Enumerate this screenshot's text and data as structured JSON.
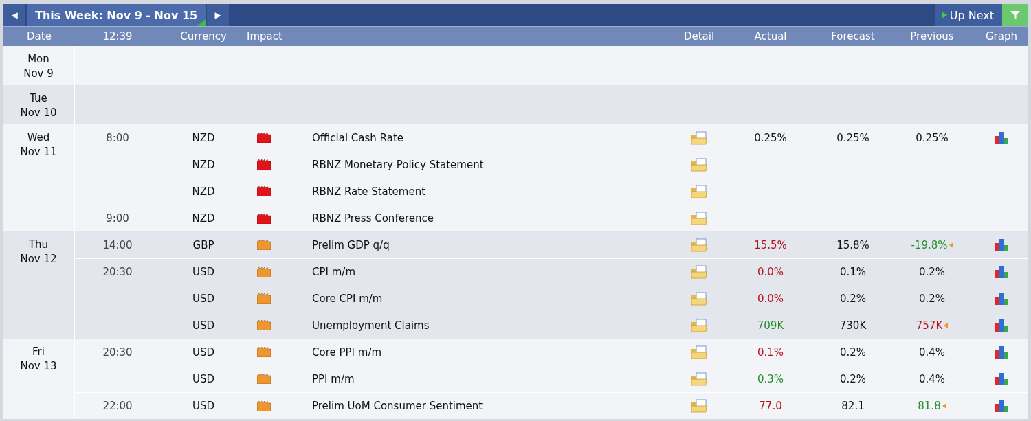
{
  "toolbar": {
    "prev": "◀",
    "title": "This Week: Nov 9 - Nov 15",
    "next": "▶",
    "up_next": "Up Next"
  },
  "columns": {
    "date": "Date",
    "time": "12:39",
    "currency": "Currency",
    "impact": "Impact",
    "detail": "Detail",
    "actual": "Actual",
    "forecast": "Forecast",
    "previous": "Previous",
    "graph": "Graph"
  },
  "days": [
    {
      "weekday": "Mon",
      "date": "Nov 9"
    },
    {
      "weekday": "Tue",
      "date": "Nov 10"
    },
    {
      "weekday": "Wed",
      "date": "Nov 11",
      "events": [
        {
          "time": "8:00",
          "currency": "NZD",
          "high_impact": true,
          "title": "Official Cash Rate",
          "actual": {
            "text": "0.25%",
            "color": "#111111"
          },
          "forecast": "0.25%",
          "previous": {
            "text": "0.25%",
            "color": "#111111"
          },
          "graph": true
        },
        {
          "currency": "NZD",
          "high_impact": true,
          "title": "RBNZ Monetary Policy Statement",
          "graph": false
        },
        {
          "currency": "NZD",
          "high_impact": true,
          "title": "RBNZ Rate Statement",
          "graph": false
        },
        {
          "time": "9:00",
          "currency": "NZD",
          "high_impact": true,
          "title": "RBNZ Press Conference",
          "graph": false
        }
      ]
    },
    {
      "weekday": "Thu",
      "date": "Nov 12",
      "events": [
        {
          "time": "14:00",
          "currency": "GBP",
          "high_impact": false,
          "title": "Prelim GDP q/q",
          "actual": {
            "text": "15.5%",
            "color": "#b4151b"
          },
          "forecast": "15.8%",
          "previous": {
            "text": "-19.8%",
            "color": "#22902a"
          },
          "revised": true,
          "graph": true
        },
        {
          "time": "20:30",
          "currency": "USD",
          "high_impact": false,
          "title": "CPI m/m",
          "actual": {
            "text": "0.0%",
            "color": "#b4151b"
          },
          "forecast": "0.1%",
          "previous": {
            "text": "0.2%",
            "color": "#111111"
          },
          "graph": true
        },
        {
          "currency": "USD",
          "high_impact": false,
          "title": "Core CPI m/m",
          "actual": {
            "text": "0.0%",
            "color": "#b4151b"
          },
          "forecast": "0.2%",
          "previous": {
            "text": "0.2%",
            "color": "#111111"
          },
          "graph": true
        },
        {
          "currency": "USD",
          "high_impact": false,
          "title": "Unemployment Claims",
          "actual": {
            "text": "709K",
            "color": "#22902a"
          },
          "forecast": "730K",
          "previous": {
            "text": "757K",
            "color": "#b4151b"
          },
          "revised": true,
          "graph": true
        }
      ]
    },
    {
      "weekday": "Fri",
      "date": "Nov 13",
      "events": [
        {
          "time": "20:30",
          "currency": "USD",
          "high_impact": false,
          "title": "Core PPI m/m",
          "actual": {
            "text": "0.1%",
            "color": "#b4151b"
          },
          "forecast": "0.2%",
          "previous": {
            "text": "0.4%",
            "color": "#111111"
          },
          "graph": true
        },
        {
          "currency": "USD",
          "high_impact": false,
          "title": "PPI m/m",
          "actual": {
            "text": "0.3%",
            "color": "#22902a"
          },
          "forecast": "0.2%",
          "previous": {
            "text": "0.4%",
            "color": "#111111"
          },
          "graph": true
        },
        {
          "time": "22:00",
          "currency": "USD",
          "high_impact": false,
          "title": "Prelim UoM Consumer Sentiment",
          "actual": {
            "text": "77.0",
            "color": "#b4151b"
          },
          "forecast": "82.1",
          "previous": {
            "text": "81.8",
            "color": "#22902a"
          },
          "revised": true,
          "graph": true
        }
      ]
    }
  ]
}
